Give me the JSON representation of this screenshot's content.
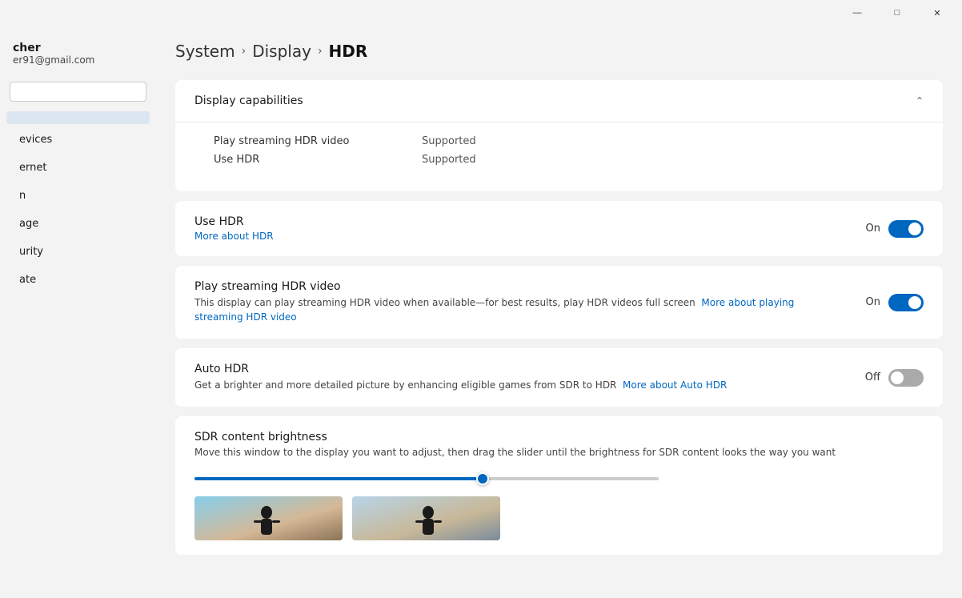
{
  "titlebar": {
    "minimize": "—",
    "maximize": "□",
    "close": "✕"
  },
  "sidebar": {
    "user_name": "cher",
    "user_email": "er91@gmail.com",
    "search_placeholder": "",
    "items": [
      {
        "label": "evices",
        "id": "devices"
      },
      {
        "label": "ernet",
        "id": "internet"
      },
      {
        "label": "n",
        "id": "personalization"
      },
      {
        "label": "age",
        "id": "storage"
      },
      {
        "label": "urity",
        "id": "security"
      },
      {
        "label": "ate",
        "id": "update"
      }
    ]
  },
  "breadcrumb": {
    "parts": [
      "System",
      "Display",
      "HDR"
    ]
  },
  "sections": {
    "display_capabilities": {
      "title": "Display capabilities",
      "expanded": true,
      "rows": [
        {
          "label": "Play streaming HDR video",
          "value": "Supported"
        },
        {
          "label": "Use HDR",
          "value": "Supported"
        }
      ]
    },
    "use_hdr": {
      "title": "Use HDR",
      "link_text": "More about HDR",
      "state": "On",
      "on": true
    },
    "play_streaming": {
      "title": "Play streaming HDR video",
      "desc": "This display can play streaming HDR video when available—for best results, play HDR videos full screen",
      "link_text": "More about playing streaming HDR video",
      "state": "On",
      "on": true
    },
    "auto_hdr": {
      "title": "Auto HDR",
      "desc": "Get a brighter and more detailed picture by enhancing eligible games from SDR to HDR",
      "link_text": "More about Auto HDR",
      "state": "Off",
      "on": false
    },
    "sdr_brightness": {
      "title": "SDR content brightness",
      "desc": "Move this window to the display you want to adjust, then drag the slider until the brightness for SDR content looks the way you want",
      "slider_percent": 62
    }
  }
}
